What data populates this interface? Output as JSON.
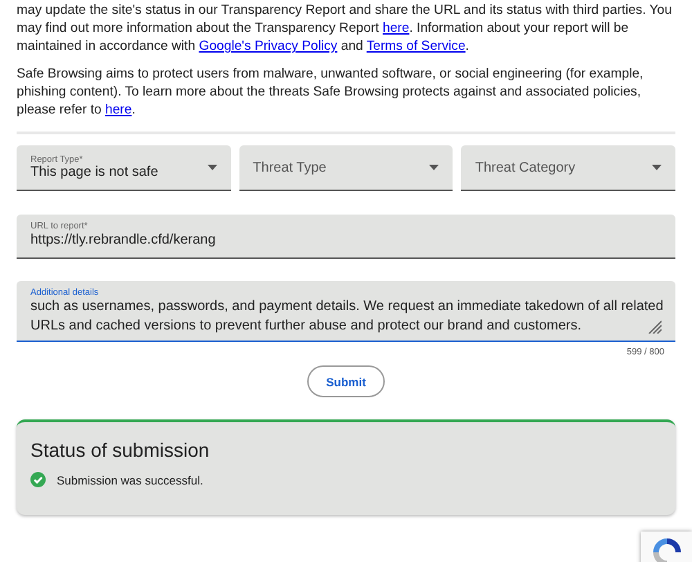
{
  "intro_paragraphs": [
    [
      {
        "kind": "text",
        "text": "may update the site's status in our Transparency Report and share the URL and its status with third parties. You may find out more information about the Transparency Report "
      },
      {
        "kind": "link",
        "text": "here"
      },
      {
        "kind": "text",
        "text": ". Information about your report will be maintained in accordance with "
      },
      {
        "kind": "link",
        "text": "Google's Privacy Policy"
      },
      {
        "kind": "text",
        "text": " and "
      },
      {
        "kind": "link",
        "text": "Terms of Service"
      },
      {
        "kind": "text",
        "text": "."
      }
    ],
    [
      {
        "kind": "text",
        "text": "Safe Browsing aims to protect users from malware, unwanted software, or social engineering (for example, phishing content). To learn more about the threats Safe Browsing protects against and associated policies, please refer to "
      },
      {
        "kind": "link",
        "text": "here"
      },
      {
        "kind": "text",
        "text": "."
      }
    ]
  ],
  "selects": [
    {
      "label": "Report Type*",
      "value": "This page is not safe"
    },
    {
      "placeholder": "Threat Type"
    },
    {
      "placeholder": "Threat Category"
    }
  ],
  "url_field": {
    "label": "URL to report*",
    "value": "https://tly.rebrandle.cfd/kerang"
  },
  "details_field": {
    "label": "Additional details",
    "focused": true,
    "lines": [
      "such as usernames, passwords, and payment details. We request an immediate takedown of all related",
      "URLs and cached versions to prevent further abuse and protect our brand and customers."
    ],
    "counter": "599 / 800"
  },
  "submit": "Submit",
  "status": {
    "title": "Status of submission",
    "message": "Submission was successful.",
    "success": true
  }
}
